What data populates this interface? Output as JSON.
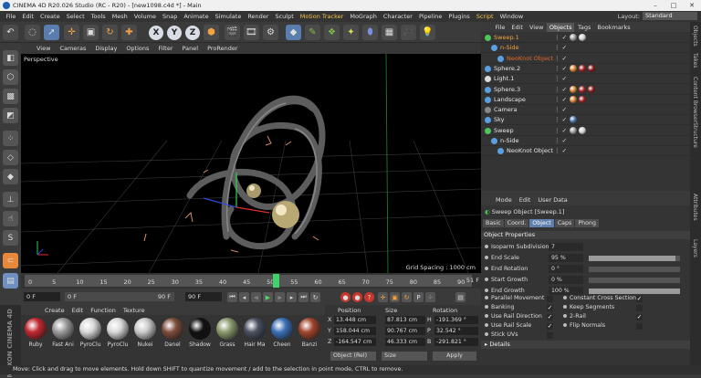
{
  "window": {
    "title": "CINEMA 4D R20.026 Studio (RC - R20) - [new1098.c4d *] - Main",
    "controls": [
      "–",
      "□",
      "✕"
    ]
  },
  "menubar": {
    "items": [
      "File",
      "Edit",
      "Create",
      "Select",
      "Tools",
      "Mesh",
      "Volume",
      "Snap",
      "Animate",
      "Simulate",
      "Render",
      "Sculpt",
      "Motion Tracker",
      "MoGraph",
      "Character",
      "Pipeline",
      "Plugins",
      "Script",
      "Window"
    ],
    "highlighted": [
      "Motion Tracker",
      "Script"
    ],
    "layout_label": "Layout:",
    "layout_value": "Standard"
  },
  "toolbar": {
    "x": "X",
    "y": "Y",
    "z": "Z"
  },
  "viewport": {
    "menu": [
      "View",
      "Cameras",
      "Display",
      "Options",
      "Filter",
      "Panel",
      "ProRender"
    ],
    "label": "Perspective",
    "grid_spacing": "Grid Spacing : 1000 cm"
  },
  "timeline": {
    "ticks": [
      "0",
      "5",
      "10",
      "15",
      "20",
      "25",
      "30",
      "35",
      "40",
      "45",
      "50",
      "55",
      "60",
      "65",
      "70",
      "75",
      "80",
      "85",
      "90"
    ],
    "current_frame": 52,
    "end_label": "51 F"
  },
  "transport": {
    "start": "0 F",
    "min": "0 F",
    "max": "90 F",
    "end": "90 F"
  },
  "materials": {
    "tabs": [
      "Create",
      "Edit",
      "Function",
      "Texture"
    ],
    "items": [
      {
        "name": "Ruby",
        "color": "#c0282f"
      },
      {
        "name": "Fast Ani",
        "color": "#9a9a9a"
      },
      {
        "name": "PyroClu",
        "color": "#d8d8d8"
      },
      {
        "name": "PyroClu",
        "color": "#d8d8d8"
      },
      {
        "name": "Nukei",
        "color": "#c9c9c9"
      },
      {
        "name": "Danel",
        "color": "#7d4d3c"
      },
      {
        "name": "Shadow",
        "color": "#111111"
      },
      {
        "name": "Grass",
        "color": "#8a9a6e"
      },
      {
        "name": "Hair Ma",
        "color": "#4b5060"
      },
      {
        "name": "Cheen",
        "color": "#3c6fb5"
      },
      {
        "name": "Banzi",
        "color": "#a0452e"
      }
    ]
  },
  "coords": {
    "heads": [
      "Position",
      "Size",
      "Rotation"
    ],
    "rows": [
      {
        "a": "X",
        "pos": "13.448 cm",
        "size": "87.813 cm",
        "rl": "H",
        "rot": "-191.369 °"
      },
      {
        "a": "Y",
        "pos": "158.044 cm",
        "size": "90.767 cm",
        "rl": "P",
        "rot": "32.542 °"
      },
      {
        "a": "Z",
        "pos": "-164.547 cm",
        "size": "46.333 cm",
        "rl": "B",
        "rot": "-291.821 °"
      }
    ],
    "mode": "Object (Rel)",
    "size_mode": "Size",
    "apply": "Apply"
  },
  "objects": {
    "menu": [
      "File",
      "Edit",
      "View",
      "Objects",
      "Tags",
      "Bookmarks"
    ],
    "active_menu": "Objects",
    "rows": [
      {
        "name": "Sweep.1",
        "indent": 0,
        "color": "#f4a340",
        "icon": "#4fc45c",
        "tags": [
          "#999999",
          "#cfcfcf"
        ]
      },
      {
        "name": "n-Side",
        "indent": 1,
        "color": "#f4a340",
        "icon": "#5aa0e0",
        "tags": []
      },
      {
        "name": "NeoKnot Object",
        "indent": 2,
        "color": "#e06a2a",
        "icon": "#5aa0e0",
        "tags": []
      },
      {
        "name": "Sphere.2",
        "indent": 0,
        "color": "#e6e6e6",
        "icon": "#5aa0e0",
        "tags": [
          "#d08030",
          "#a02020",
          "#8a1a1a"
        ]
      },
      {
        "name": "Light.1",
        "indent": 0,
        "color": "#e6e6e6",
        "icon": "#dddddd",
        "tags": []
      },
      {
        "name": "Sphere.3",
        "indent": 0,
        "color": "#e6e6e6",
        "icon": "#5aa0e0",
        "tags": [
          "#d08030",
          "#a02020",
          "#8a1a1a"
        ]
      },
      {
        "name": "Landscape",
        "indent": 0,
        "color": "#e6e6e6",
        "icon": "#5aa0e0",
        "tags": [
          "#d08030",
          "#a02020"
        ]
      },
      {
        "name": "Camera",
        "indent": 0,
        "color": "#e6e6e6",
        "icon": "#888888",
        "tags": []
      },
      {
        "name": "Sky",
        "indent": 0,
        "color": "#e6e6e6",
        "icon": "#5aa0e0",
        "tags": [
          "#4a78b0"
        ]
      },
      {
        "name": "Sweep",
        "indent": 0,
        "color": "#e6e6e6",
        "icon": "#4fc45c",
        "tags": [
          "#999999",
          "#cfcfcf"
        ]
      },
      {
        "name": "n-Side",
        "indent": 1,
        "color": "#e6e6e6",
        "icon": "#5aa0e0",
        "tags": []
      },
      {
        "name": "NeoKnot Object",
        "indent": 2,
        "color": "#e6e6e6",
        "icon": "#5aa0e0",
        "tags": []
      }
    ]
  },
  "side_tabs": [
    "Objects",
    "Takes",
    "Content Browser",
    "Structure",
    "Attributes",
    "Layers"
  ],
  "attributes": {
    "menu": [
      "Mode",
      "Edit",
      "User Data"
    ],
    "title": "Sweep Object [Sweep.1]",
    "tabs": [
      "Basic",
      "Coord.",
      "Object",
      "Caps",
      "Phong"
    ],
    "active_tab": "Object",
    "section": "Object Properties",
    "fields": [
      {
        "label": "Isoparm Subdivision",
        "value": "7",
        "fill": null
      },
      {
        "label": "End Scale",
        "value": "95 %",
        "fill": 0.95
      },
      {
        "label": "End Rotation",
        "value": "0 °",
        "fill": 0
      },
      {
        "label": "Start Growth",
        "value": "0 %",
        "fill": 0
      },
      {
        "label": "End Growth",
        "value": "100 %",
        "fill": 1.0
      }
    ],
    "checks_left": [
      {
        "label": "Parallel Movement",
        "checked": ""
      },
      {
        "label": "Banking",
        "checked": "✓"
      },
      {
        "label": "Use Rail Direction",
        "checked": "✓"
      },
      {
        "label": "Use Rail Scale",
        "checked": "✓"
      },
      {
        "label": "Stick UVs",
        "checked": ""
      }
    ],
    "checks_right": [
      {
        "label": "Constant Cross Section",
        "checked": "✓"
      },
      {
        "label": "Keep Segments",
        "checked": ""
      },
      {
        "label": "2-Rail",
        "checked": "✓"
      },
      {
        "label": "Flip Normals",
        "checked": ""
      }
    ],
    "details": "Details"
  },
  "status": "Move: Click and drag to move elements. Hold down SHIFT to quantize movement / add to the selection in point mode, CTRL to remove.",
  "logo": "MAXON CINEMA 4D"
}
